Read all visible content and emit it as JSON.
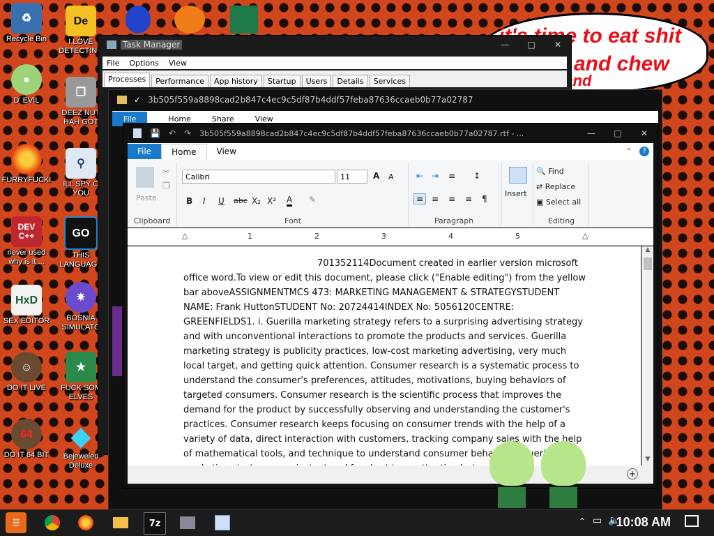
{
  "desktop": {
    "icons": [
      {
        "label": "Recycle Bin"
      },
      {
        "label": "D' EVIL"
      },
      {
        "label": "FURRYFUCK!"
      },
      {
        "label": "never used why is it ..."
      },
      {
        "label": "SEX EDITOR"
      },
      {
        "label": "DO IT LIVE"
      },
      {
        "label": "DO IT 64 BIT"
      },
      {
        "label": "I LOVE DETECTING"
      },
      {
        "label": "DEEZ NUT HAH GOT"
      },
      {
        "label": "ILL SPY O YOU"
      },
      {
        "label": "THIS LANGUAGE"
      },
      {
        "label": "BOSNIA SIMULATO"
      },
      {
        "label": "FUCK SOM ELVES"
      },
      {
        "label": "Bejeweled Deluxe"
      }
    ],
    "icon_glyphs": {
      "dev": "DEV C++",
      "go": "GO",
      "hxd": "HxD",
      "de": "De",
      "sixtyfour": "64"
    },
    "bubble_lines": [
      "it's time to eat shit",
      "and chew",
      "s and"
    ]
  },
  "task_manager": {
    "title": "Task Manager",
    "menu": [
      "File",
      "Options",
      "View"
    ],
    "tabs": [
      "Processes",
      "Performance",
      "App history",
      "Startup",
      "Users",
      "Details",
      "Services"
    ]
  },
  "explorer": {
    "title": "3b505f559a8898cad2b847c4ec9c5df87b4ddf57feba87636ccaeb0b77a02787",
    "ribbon_tabs": [
      "File",
      "Home",
      "Share",
      "View"
    ]
  },
  "wordpad": {
    "title": "3b505f559a8898cad2b847c4ec9c5df87b4ddf57feba87636ccaeb0b77a02787.rtf - ...",
    "tabs": [
      "File",
      "Home",
      "View"
    ],
    "font_name": "Calibri",
    "font_size": "11",
    "groups": {
      "clipboard": "Clipboard",
      "font": "Font",
      "paragraph": "Paragraph",
      "editing": "Editing"
    },
    "buttons": {
      "paste": "Paste",
      "insert": "Insert",
      "find": "Find",
      "replace": "Replace",
      "select_all": "Select all"
    },
    "ruler_numbers": [
      "1",
      "2",
      "3",
      "4",
      "5"
    ],
    "document_text": "701352114Document created in earlier version microsoft office word.To view or edit this document, please click (\"Enable editing\") from the yellow bar aboveASSIGNMENTMCS 473: MARKETING MANAGEMENT & STRATEGYSTUDENT NAME: Frank HuttonSTUDENT No: 20724414INDEX No: 5056120CENTRE: GREENFIELDS1. i. Guerilla marketing strategy refers to a surprising advertising strategy and with unconventional interactions to promote the products and services. Guerilla marketing strategy is publicity practices, low-cost marketing advertising, very much local target, and getting quick attention. Consumer research is a systematic process to understand the consumer's preferences, attitudes, motivations, buying behaviors of targeted consumers. Consumer research is the scientific process that improves the demand for the product by successfully observing and understanding the customer's practices. Consumer research keeps focusing on consumer trends with the help of a variety of data, direct interaction with customers, tracking company sales with the help of mathematical tools, and technique to understand consumer behaviors. Guerilla marketing strategy very instant and for short term attention but consumer re"
  },
  "taskbar": {
    "clock": "10:08 AM",
    "app_7z": "7z"
  },
  "colors": {
    "accent": "#1979ca",
    "desktop_bg": "#d2461e",
    "window_dark": "#111111"
  }
}
